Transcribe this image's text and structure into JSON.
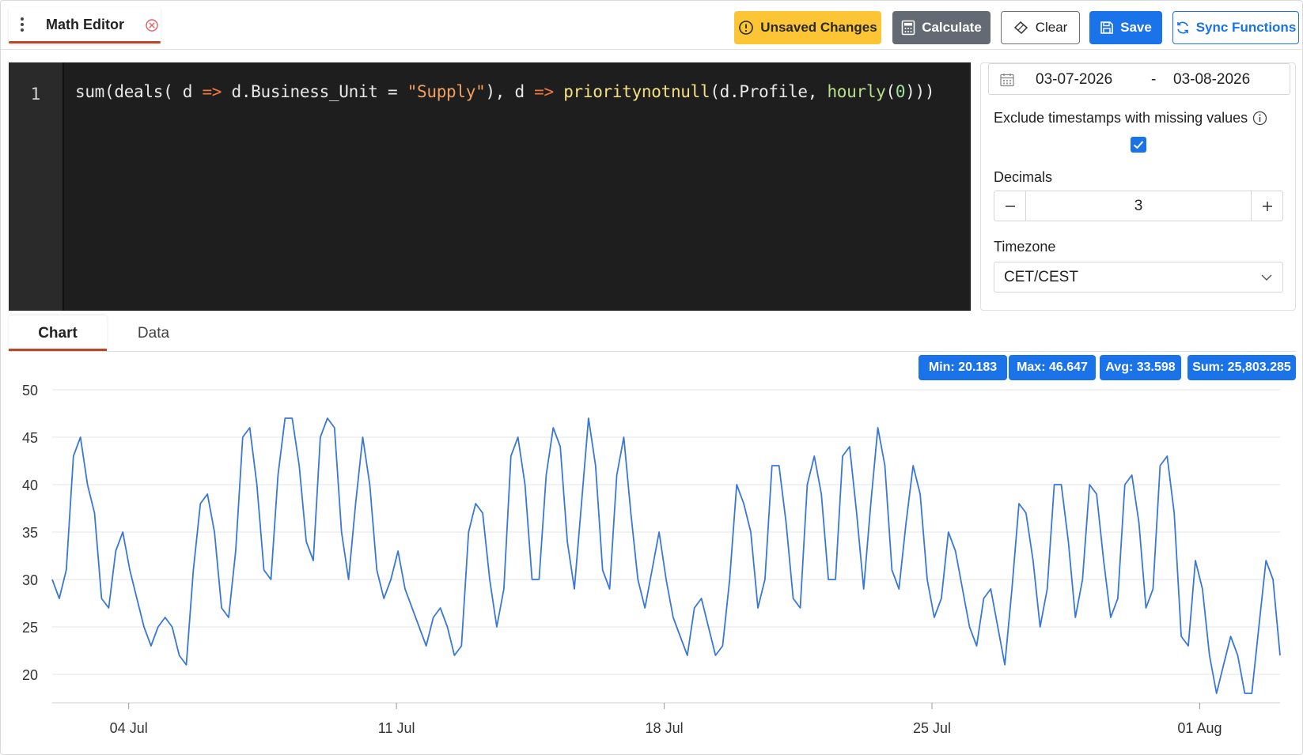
{
  "doc_tab": {
    "title": "Math Editor"
  },
  "toolbar": {
    "unsaved_label": "Unsaved Changes",
    "calculate_label": "Calculate",
    "clear_label": "Clear",
    "save_label": "Save",
    "sync_label": "Sync Functions"
  },
  "editor": {
    "line_number": "1",
    "tokens": [
      "sum(deals( d ",
      "=>",
      " d.Business_Unit = ",
      "\"Supply\"",
      "), d ",
      "=>",
      " ",
      "prioritynotnull",
      "(d.Profile, ",
      "hourly",
      "(",
      "0",
      ")))"
    ]
  },
  "panel": {
    "date_from": "03-07-2026",
    "date_sep": "-",
    "date_to": "03-08-2026",
    "exclude_label": "Exclude timestamps with missing values",
    "exclude_checked": true,
    "decimals_label": "Decimals",
    "decimals_value": "3",
    "timezone_label": "Timezone",
    "timezone_value": "CET/CEST"
  },
  "tabs": {
    "chart": "Chart",
    "data": "Data"
  },
  "stats": {
    "min": "Min: 20.183",
    "max": "Max: 46.647",
    "avg": "Avg: 33.598",
    "sum": "Sum: 25,803.285"
  },
  "colors": {
    "accent": "#1a73e8",
    "warning": "#fbc535",
    "tab_underline": "#b84a2a",
    "line": "#3a78d6"
  },
  "chart_data": {
    "type": "line",
    "ylim": [
      18,
      50
    ],
    "yticks": [
      20,
      25,
      30,
      35,
      40,
      45,
      50
    ],
    "xtick_labels": [
      "04 Jul",
      "11 Jul",
      "18 Jul",
      "25 Jul",
      "01 Aug"
    ],
    "xtick_days": [
      3,
      10,
      17,
      24,
      31
    ],
    "x_start_day": 1,
    "x_end_day": 33.1,
    "series": [
      {
        "values": [
          30,
          28,
          31,
          43,
          45,
          40,
          37,
          28,
          27,
          33,
          35,
          31,
          28,
          25,
          23,
          25,
          26,
          25,
          22,
          21,
          31,
          38,
          39,
          35,
          27,
          26,
          33,
          45,
          46,
          40,
          31,
          30,
          41,
          47,
          47,
          42,
          34,
          32,
          45,
          47,
          46,
          35,
          30,
          38,
          45,
          40,
          31,
          28,
          30,
          33,
          29,
          27,
          25,
          23,
          26,
          27,
          25,
          22,
          23,
          35,
          38,
          37,
          30,
          25,
          29,
          43,
          45,
          40,
          30,
          30,
          41,
          46,
          44,
          34,
          29,
          38,
          47,
          42,
          31,
          29,
          41,
          45,
          37,
          30,
          27,
          31,
          35,
          30,
          26,
          24,
          22,
          27,
          28,
          25,
          22,
          23,
          30,
          40,
          38,
          35,
          27,
          30,
          42,
          42,
          36,
          28,
          27,
          40,
          43,
          39,
          30,
          30,
          43,
          44,
          37,
          29,
          38,
          46,
          42,
          31,
          29,
          36,
          42,
          39,
          30,
          26,
          28,
          35,
          33,
          29,
          25,
          23,
          28,
          29,
          25,
          21,
          29,
          38,
          37,
          32,
          25,
          29,
          40,
          40,
          34,
          26,
          30,
          40,
          39,
          32,
          26,
          28,
          40,
          41,
          36,
          27,
          29,
          42,
          43,
          37,
          24,
          23,
          32,
          29,
          22,
          18,
          21,
          24,
          22,
          18,
          18,
          25,
          32,
          30,
          22
        ]
      }
    ]
  }
}
